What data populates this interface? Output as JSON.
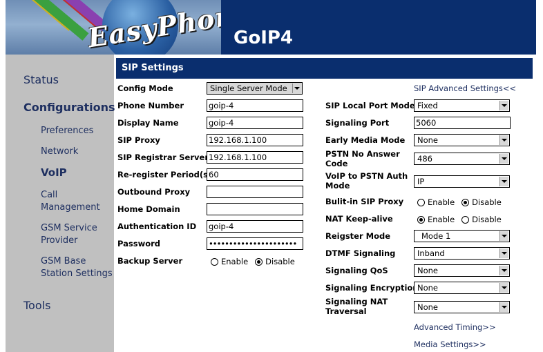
{
  "header": {
    "logo_text": "EasyPhone",
    "model": "GoIP4",
    "colors": {
      "banner": "#0a2e6e",
      "sidebar": "#c0c0c0",
      "link": "#1e2f60"
    }
  },
  "sidebar": {
    "status": "Status",
    "configurations": "Configurations",
    "items": [
      {
        "line1": "Preferences",
        "line2": ""
      },
      {
        "line1": "Network",
        "line2": ""
      },
      {
        "line1": "VoIP",
        "line2": "",
        "active": true
      },
      {
        "line1": "Call",
        "line2": "Management"
      },
      {
        "line1": "GSM Service",
        "line2": "Provider"
      },
      {
        "line1": "GSM Base",
        "line2": "Station Settings"
      }
    ],
    "tools": "Tools"
  },
  "panel": {
    "title": "SIP Settings"
  },
  "left": {
    "config_mode": {
      "label": "Config Mode",
      "value": "Single Server Mode"
    },
    "phone_number": {
      "label": "Phone Number",
      "value": "goip-4"
    },
    "display_name": {
      "label": "Display Name",
      "value": "goip-4"
    },
    "sip_proxy": {
      "label": "SIP Proxy",
      "value": "192.168.1.100"
    },
    "sip_registrar": {
      "label": "SIP Registrar Server",
      "value": "192.168.1.100"
    },
    "reregister": {
      "label": "Re-register Period(s)",
      "value": "60"
    },
    "outbound_proxy": {
      "label": "Outbound Proxy",
      "value": ""
    },
    "home_domain": {
      "label": "Home Domain",
      "value": ""
    },
    "auth_id": {
      "label": "Authentication ID",
      "value": "goip-4"
    },
    "password": {
      "label": "Password",
      "value": "••••••••••••••••••••••"
    },
    "backup_server": {
      "label": "Backup Server",
      "enable": "Enable",
      "disable": "Disable",
      "selected": "disable"
    }
  },
  "right": {
    "advanced_link": "SIP Advanced Settings<<",
    "local_port_mode": {
      "label": "SIP Local Port Mode",
      "value": "Fixed"
    },
    "signaling_port": {
      "label": "Signaling Port",
      "value": "5060"
    },
    "early_media": {
      "label": "Early Media Mode",
      "value": "None"
    },
    "pstn_no_answer": {
      "label1": "PSTN No Answer",
      "label2": "Code",
      "value": "486"
    },
    "voip_to_pstn": {
      "label1": "VoIP to PSTN Auth",
      "label2": "Mode",
      "value": "IP"
    },
    "builtin_proxy": {
      "label": "Bulit-in SIP Proxy",
      "enable": "Enable",
      "disable": "Disable",
      "selected": "disable"
    },
    "nat_keepalive": {
      "label": "NAT Keep-alive",
      "enable": "Enable",
      "disable": "Disable",
      "selected": "enable"
    },
    "register_mode": {
      "label": "Reigster Mode",
      "value": "Mode 1"
    },
    "dtmf": {
      "label": "DTMF Signaling",
      "value": "Inband"
    },
    "qos": {
      "label": "Signaling QoS",
      "value": "None"
    },
    "encryption": {
      "label": "Signaling Encryption",
      "value": "None"
    },
    "nat_traversal": {
      "label1": "Signaling NAT",
      "label2": "Traversal",
      "value": "None"
    },
    "advanced_timing": "Advanced Timing>>",
    "media_settings": "Media Settings>>"
  }
}
